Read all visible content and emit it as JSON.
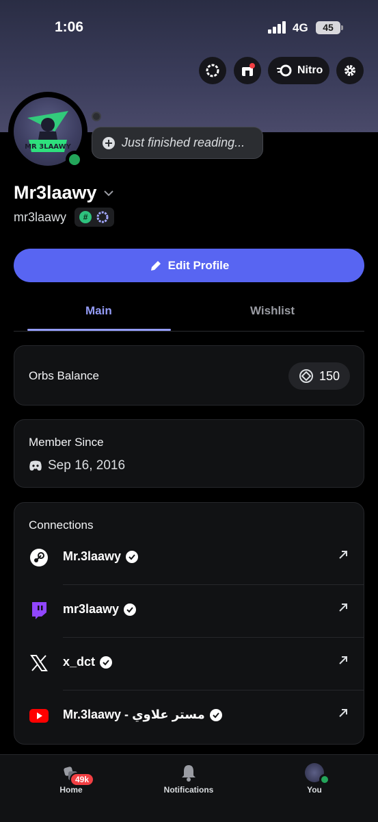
{
  "status_bar": {
    "time": "1:06",
    "network": "4G",
    "battery": "45"
  },
  "header": {
    "nitro_label": "Nitro"
  },
  "avatar": {
    "logo_text": "MR 3LAAWY"
  },
  "custom_status": {
    "text": "Just finished reading..."
  },
  "profile": {
    "display_name": "Mr3laawy",
    "handle": "mr3laawy",
    "badge_hash": "#"
  },
  "edit_button": {
    "label": "Edit Profile"
  },
  "tabs": [
    {
      "label": "Main"
    },
    {
      "label": "Wishlist"
    }
  ],
  "orbs": {
    "label": "Orbs Balance",
    "value": "150"
  },
  "member_since": {
    "title": "Member Since",
    "date": "Sep 16, 2016"
  },
  "connections": {
    "title": "Connections",
    "items": [
      {
        "service": "steam-icon",
        "name": "Mr.3laawy"
      },
      {
        "service": "twitch-icon",
        "name": "mr3laawy"
      },
      {
        "service": "x-icon",
        "name": "x_dct"
      },
      {
        "service": "youtube-icon",
        "name": "Mr.3laawy - مستر علاوي"
      }
    ]
  },
  "bottom_nav": {
    "home": "Home",
    "home_badge": "49k",
    "notifications": "Notifications",
    "you": "You"
  },
  "colors": {
    "accent": "#5865f2",
    "tab_active": "#949cf7",
    "online": "#23a55a",
    "badge_red": "#f23f43"
  }
}
